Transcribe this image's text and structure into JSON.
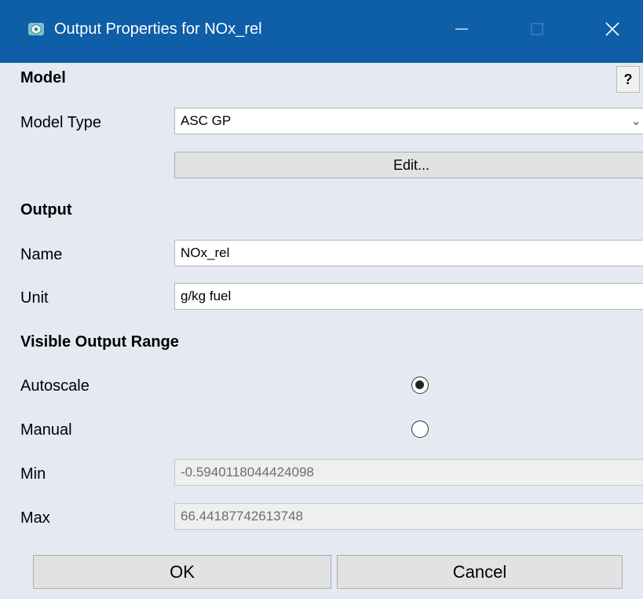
{
  "window": {
    "title": "Output Properties for NOx_rel"
  },
  "model": {
    "section_label": "Model",
    "help_label": "?",
    "type_label": "Model Type",
    "type_value": "ASC GP",
    "edit_label": "Edit..."
  },
  "output": {
    "section_label": "Output",
    "name_label": "Name",
    "name_value": "NOx_rel",
    "unit_label": "Unit",
    "unit_value": "g/kg fuel"
  },
  "range": {
    "section_label": "Visible Output Range",
    "autoscale_label": "Autoscale",
    "autoscale_selected": true,
    "manual_label": "Manual",
    "manual_selected": false,
    "min_label": "Min",
    "min_value": "-0.5940118044424098",
    "max_label": "Max",
    "max_value": "66.44187742613748"
  },
  "buttons": {
    "ok_label": "OK",
    "cancel_label": "Cancel"
  }
}
